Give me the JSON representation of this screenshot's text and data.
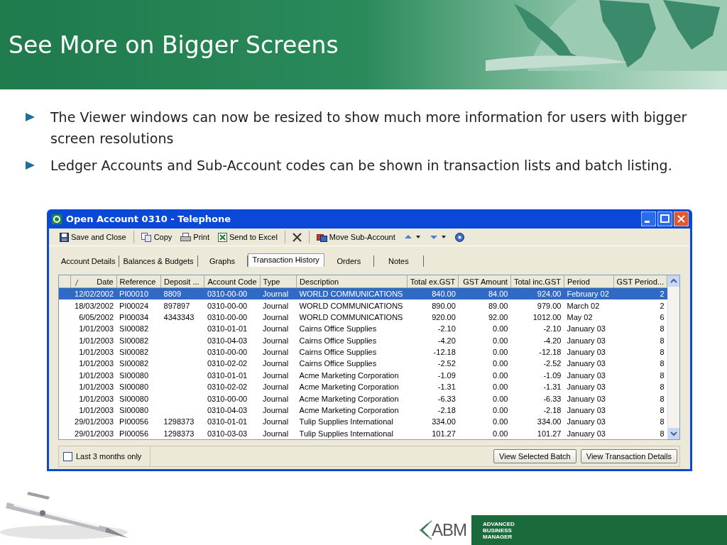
{
  "slide": {
    "title": "See More on Bigger Screens",
    "bullets": [
      "The Viewer windows can now be resized to show much more information for users with bigger screen resolutions",
      "Ledger Accounts and Sub-Account codes can be shown in transaction lists and batch listing."
    ]
  },
  "window": {
    "title": "Open Account 0310 - Telephone",
    "toolbar": [
      {
        "kind": "save",
        "label": "Save and Close"
      },
      {
        "kind": "copy",
        "label": "Copy"
      },
      {
        "kind": "print",
        "label": "Print"
      },
      {
        "kind": "excel",
        "label": "Send to Excel"
      },
      {
        "kind": "delete"
      },
      {
        "kind": "move",
        "label": "Move Sub-Account"
      },
      {
        "kind": "up"
      },
      {
        "kind": "down"
      },
      {
        "kind": "help"
      }
    ],
    "tabs": [
      {
        "label": "Account Details",
        "selected": false
      },
      {
        "label": "Balances & Budgets",
        "selected": false
      },
      {
        "label": "Graphs",
        "selected": false
      },
      {
        "label": "Transaction History",
        "selected": true
      },
      {
        "label": "Orders",
        "selected": false
      },
      {
        "label": "Notes",
        "selected": false
      }
    ],
    "table": {
      "columns": [
        "Date",
        "Reference",
        "Deposit ...",
        "Account Code",
        "Type",
        "Description",
        "Total ex.GST",
        "GST Amount",
        "Total inc.GST",
        "Period",
        "GST Period..."
      ],
      "rows": [
        {
          "selected": true,
          "cells": [
            "12/02/2002",
            "PI00010",
            "8809",
            "0310-00-00",
            "Journal",
            "WORLD COMMUNICATIONS",
            "840.00",
            "84.00",
            "924.00",
            "February 02",
            "2"
          ]
        },
        {
          "selected": false,
          "cells": [
            "18/03/2002",
            "PI00024",
            "897897",
            "0310-00-00",
            "Journal",
            "WORLD COMMUNICATIONS",
            "890.00",
            "89.00",
            "979.00",
            "March 02",
            "2"
          ]
        },
        {
          "selected": false,
          "cells": [
            "6/05/2002",
            "PI00034",
            "4343343",
            "0310-00-00",
            "Journal",
            "WORLD COMMUNICATIONS",
            "920.00",
            "92.00",
            "1012.00",
            "May 02",
            "6"
          ]
        },
        {
          "selected": false,
          "cells": [
            "1/01/2003",
            "SI00082",
            "",
            "0310-01-01",
            "Journal",
            "Cairns Office Supplies",
            "-2.10",
            "0.00",
            "-2.10",
            "January 03",
            "8"
          ]
        },
        {
          "selected": false,
          "cells": [
            "1/01/2003",
            "SI00082",
            "",
            "0310-04-03",
            "Journal",
            "Cairns Office Supplies",
            "-4.20",
            "0.00",
            "-4.20",
            "January 03",
            "8"
          ]
        },
        {
          "selected": false,
          "cells": [
            "1/01/2003",
            "SI00082",
            "",
            "0310-00-00",
            "Journal",
            "Cairns Office Supplies",
            "-12.18",
            "0.00",
            "-12.18",
            "January 03",
            "8"
          ]
        },
        {
          "selected": false,
          "cells": [
            "1/01/2003",
            "SI00082",
            "",
            "0310-02-02",
            "Journal",
            "Cairns Office Supplies",
            "-2.52",
            "0.00",
            "-2.52",
            "January 03",
            "8"
          ]
        },
        {
          "selected": false,
          "cells": [
            "1/01/2003",
            "SI00080",
            "",
            "0310-01-01",
            "Journal",
            "Acme Marketing Corporation",
            "-1.09",
            "0.00",
            "-1.09",
            "January 03",
            "8"
          ]
        },
        {
          "selected": false,
          "cells": [
            "1/01/2003",
            "SI00080",
            "",
            "0310-02-02",
            "Journal",
            "Acme Marketing Corporation",
            "-1.31",
            "0.00",
            "-1.31",
            "January 03",
            "8"
          ]
        },
        {
          "selected": false,
          "cells": [
            "1/01/2003",
            "SI00080",
            "",
            "0310-00-00",
            "Journal",
            "Acme Marketing Corporation",
            "-6.33",
            "0.00",
            "-6.33",
            "January 03",
            "8"
          ]
        },
        {
          "selected": false,
          "cells": [
            "1/01/2003",
            "SI00080",
            "",
            "0310-04-03",
            "Journal",
            "Acme Marketing Corporation",
            "-2.18",
            "0.00",
            "-2.18",
            "January 03",
            "8"
          ]
        },
        {
          "selected": false,
          "cells": [
            "29/01/2003",
            "PI00056",
            "1298373",
            "0310-01-01",
            "Journal",
            "Tulip Supplies International",
            "334.00",
            "0.00",
            "334.00",
            "January 03",
            "8"
          ]
        },
        {
          "selected": false,
          "cells": [
            "29/01/2003",
            "PI00056",
            "1298373",
            "0310-03-03",
            "Journal",
            "Tulip Supplies International",
            "101.27",
            "0.00",
            "101.27",
            "January 03",
            "8"
          ]
        }
      ]
    },
    "filter": {
      "label": "Last 3 months only",
      "checked": false
    },
    "buttons": [
      "View Selected Batch",
      "View Transaction Details"
    ]
  },
  "footer": {
    "logo": "ABM",
    "tagline": [
      "ADVANCED",
      "BUSINESS",
      "MANAGER"
    ]
  }
}
